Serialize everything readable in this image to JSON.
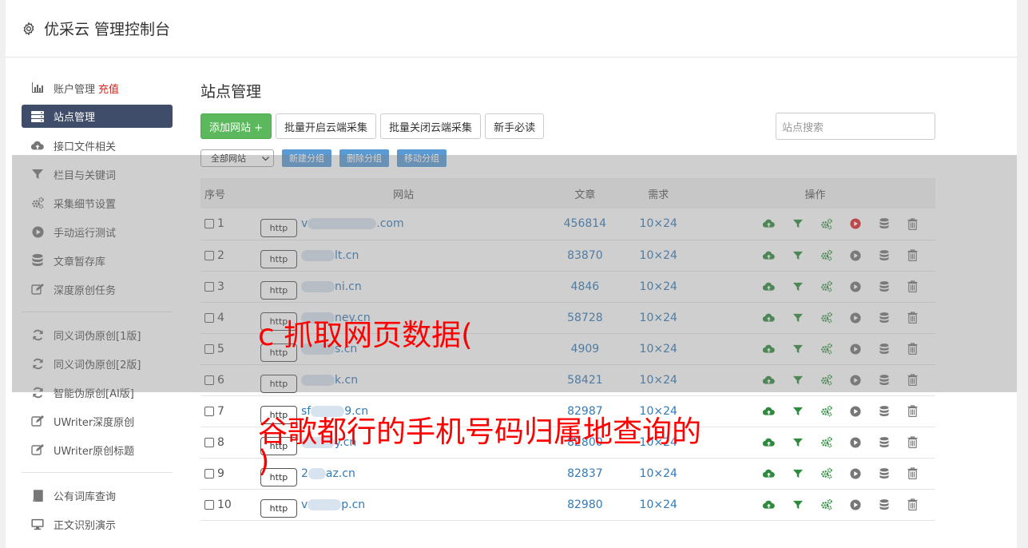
{
  "header": {
    "title": "优采云 管理控制台",
    "icon": "gear-icon"
  },
  "sidebar": {
    "items": [
      {
        "label": "账户管理",
        "badge": "充值",
        "icon": "bar-chart-icon",
        "active": false
      },
      {
        "label": "站点管理",
        "icon": "server-icon",
        "active": true
      },
      {
        "label": "接口文件相关",
        "icon": "cloud-upload-icon",
        "active": false
      },
      {
        "label": "栏目与关键词",
        "icon": "filter-icon",
        "active": false
      },
      {
        "label": "采集细节设置",
        "icon": "cogs-icon",
        "active": false
      },
      {
        "label": "手动运行测试",
        "icon": "play-circle-icon",
        "active": false
      },
      {
        "label": "文章暂存库",
        "icon": "database-icon",
        "active": false
      },
      {
        "label": "深度原创任务",
        "icon": "edit-icon",
        "active": false
      }
    ],
    "items2": [
      {
        "label": "同义词伪原创[1版]",
        "icon": "refresh-icon"
      },
      {
        "label": "同义词伪原创[2版]",
        "icon": "refresh-icon"
      },
      {
        "label": "智能伪原创[AI版]",
        "icon": "refresh-icon"
      },
      {
        "label": "UWriter深度原创",
        "icon": "edit-icon"
      },
      {
        "label": "UWriter原创标题",
        "icon": "edit-icon"
      }
    ],
    "items3": [
      {
        "label": "公有词库查询",
        "icon": "book-icon"
      },
      {
        "label": "正文识别演示",
        "icon": "monitor-icon"
      }
    ]
  },
  "main": {
    "title": "站点管理",
    "toolbar": {
      "add_site": "添加网站 +",
      "batch_open": "批量开启云端采集",
      "batch_close": "批量关闭云端采集",
      "newbie": "新手必读",
      "search_placeholder": "站点搜索"
    },
    "group": {
      "select_value": "全部网站",
      "new_group": "新建分组",
      "delete_group": "删除分组",
      "move_group": "移动分组"
    },
    "table": {
      "headers": {
        "no": "序号",
        "site": "网站",
        "articles": "文章",
        "demand": "需求",
        "ops": "操作"
      },
      "rows": [
        {
          "no": "1",
          "proto": "http",
          "prefix": "v",
          "suffix": ".com",
          "articles": "456814",
          "demand": "10×24",
          "running": true
        },
        {
          "no": "2",
          "proto": "http",
          "prefix": "",
          "suffix": "lt.cn",
          "articles": "83870",
          "demand": "10×24",
          "running": false
        },
        {
          "no": "3",
          "proto": "http",
          "prefix": "",
          "suffix": "ni.cn",
          "articles": "4846",
          "demand": "10×24",
          "running": false
        },
        {
          "no": "4",
          "proto": "http",
          "prefix": "",
          "suffix": "ney.cn",
          "articles": "58728",
          "demand": "10×24",
          "running": false
        },
        {
          "no": "5",
          "proto": "http",
          "prefix": "",
          "suffix": "s.cn",
          "articles": "4909",
          "demand": "10×24",
          "running": false
        },
        {
          "no": "6",
          "proto": "http",
          "prefix": "",
          "suffix": "k.cn",
          "articles": "58421",
          "demand": "10×24",
          "running": false
        },
        {
          "no": "7",
          "proto": "http",
          "prefix": "sf",
          "suffix": "9.cn",
          "articles": "82987",
          "demand": "10×24",
          "running": false
        },
        {
          "no": "8",
          "proto": "http",
          "prefix": "",
          "suffix": "y.cn",
          "articles": "82800",
          "demand": "10×24",
          "running": false
        },
        {
          "no": "9",
          "proto": "http",
          "prefix": "2",
          "suffix": "az.cn",
          "articles": "82837",
          "demand": "10×24",
          "running": false
        },
        {
          "no": "10",
          "proto": "http",
          "prefix": "v",
          "suffix": "p.cn",
          "articles": "82980",
          "demand": "10×24",
          "running": false
        }
      ]
    }
  },
  "overlay_text": {
    "line1": "c 抓取网页数据(",
    "line2": "谷歌都行的手机号码归属地查询的",
    "line3": ")"
  },
  "colors": {
    "accent_green": "#5cb85c",
    "nav_active": "#3f4d6a",
    "link": "#337ab7",
    "danger": "#d9251d",
    "group_btn": "#5b9bd5"
  }
}
